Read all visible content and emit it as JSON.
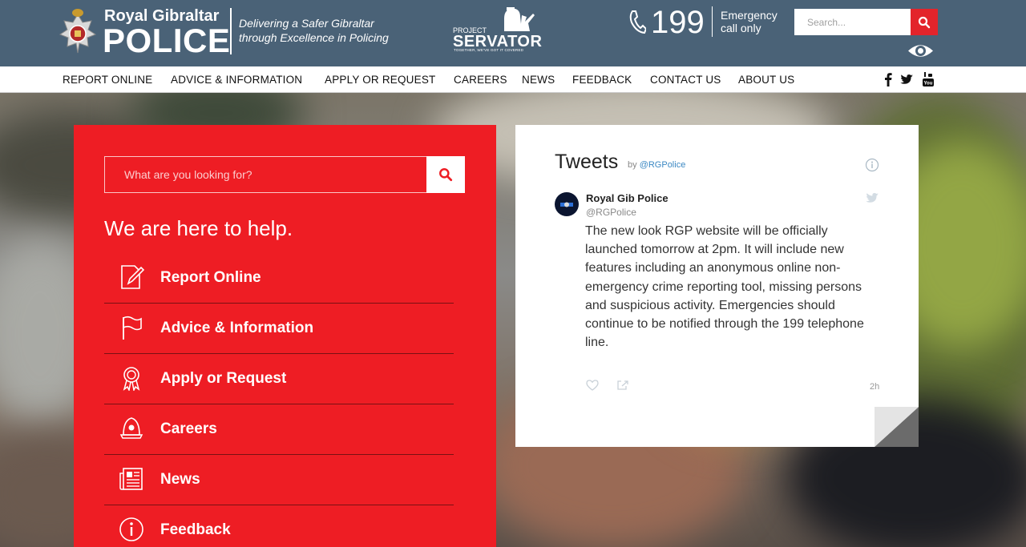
{
  "header": {
    "brand_line1": "Royal Gibraltar",
    "brand_line2": "POLICE",
    "tagline_line1": "Delivering a Safer Gibraltar",
    "tagline_line2": "through Excellence in Policing",
    "servator_small": "PROJECT",
    "servator_big": "SERVATOR",
    "servator_tagline": "TOGETHER, WE'VE GOT IT COVERED",
    "emergency_number": "199",
    "emergency_line1": "Emergency",
    "emergency_line2": "call only",
    "search_placeholder": "Search..."
  },
  "nav": {
    "items": [
      "REPORT ONLINE",
      "ADVICE & INFORMATION",
      "APPLY OR REQUEST",
      "CAREERS",
      "NEWS",
      "FEEDBACK",
      "CONTACT US",
      "ABOUT US"
    ],
    "social": [
      "facebook-icon",
      "twitter-icon",
      "youtube-icon"
    ]
  },
  "panel": {
    "search_placeholder": "What are you looking for?",
    "heading": "We are here to help.",
    "links": [
      {
        "label": "Report Online",
        "icon": "edit-document-icon"
      },
      {
        "label": "Advice & Information",
        "icon": "flag-icon"
      },
      {
        "label": "Apply or Request",
        "icon": "award-ribbon-icon"
      },
      {
        "label": "Careers",
        "icon": "police-helmet-icon"
      },
      {
        "label": "News",
        "icon": "newspaper-icon"
      },
      {
        "label": "Feedback",
        "icon": "info-circle-icon"
      }
    ]
  },
  "tweets": {
    "title": "Tweets",
    "by": "by",
    "by_handle": "@RGPolice",
    "author_name": "Royal Gib Police",
    "author_handle": "@RGPolice",
    "text": "The new look RGP website will be officially launched tomorrow at 2pm. It will include new features including an anonymous online non-emergency crime reporting tool, missing persons and suspicious activity. Emergencies should continue to be notified through the 199 telephone line.",
    "time": "2h"
  },
  "colors": {
    "header_bg": "#4a6277",
    "accent_red": "#ee1d24",
    "search_red": "#e3242b"
  }
}
